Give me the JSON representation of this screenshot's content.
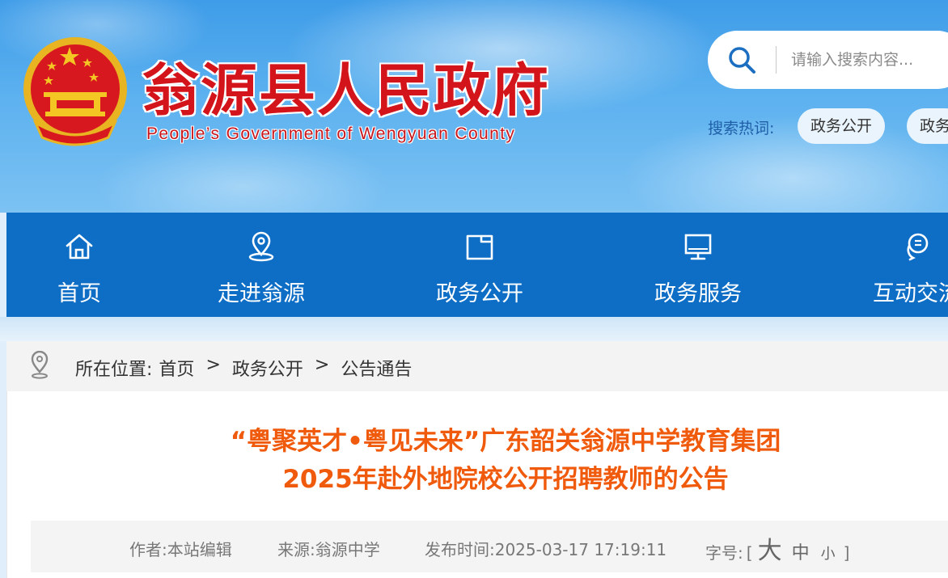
{
  "header": {
    "title": "翁源县人民政府",
    "subtitle": "People’s Government of Wengyuan County",
    "emblem": "national-emblem",
    "search": {
      "placeholder": "请输入搜索内容..."
    },
    "hot": {
      "label": "搜索热词:",
      "tags": [
        "政务公开",
        "政务"
      ]
    }
  },
  "nav": {
    "items": [
      {
        "label": "首页",
        "icon": "home-icon"
      },
      {
        "label": "走进翁源",
        "icon": "location-icon"
      },
      {
        "label": "政务公开",
        "icon": "folder-icon"
      },
      {
        "label": "政务服务",
        "icon": "monitor-icon"
      },
      {
        "label": "互动交流",
        "icon": "chat-icon"
      }
    ]
  },
  "breadcrumb": {
    "prefix": "所在位置:",
    "items": [
      "首页",
      "政务公开",
      "公告通告"
    ],
    "separator": ">"
  },
  "article": {
    "title_line1": "“粤聚英才•粤见未来”广东韶关翁源中学教育集团",
    "title_line2": "2025年赴外地院校公开招聘教师的公告",
    "author": "作者:本站编辑",
    "source": "来源:翁源中学",
    "published": "发布时间:2025-03-17 17:19:11",
    "font_size_label": "字号:",
    "font_size_open": "[",
    "font_size_big": "大",
    "font_size_mid": "中",
    "font_size_small": "小",
    "font_size_close": "]"
  },
  "colors": {
    "nav_bg": "#0e6ec6",
    "title_red": "#d3151b",
    "article_title": "#f05a0c"
  }
}
